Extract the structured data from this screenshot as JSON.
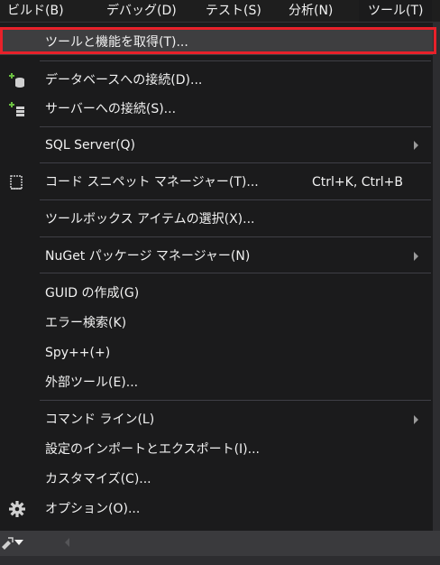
{
  "menubar": {
    "items": [
      {
        "label": "ビルド(B)"
      },
      {
        "label": "デバッグ(D)"
      },
      {
        "label": "テスト(S)"
      },
      {
        "label": "分析(N)"
      },
      {
        "label": "ツール(T)"
      }
    ]
  },
  "tools_menu": {
    "items": [
      {
        "label": "ツールと機能を取得(T)...",
        "highlighted": true
      },
      {
        "label": "データベースへの接続(D)...",
        "icon": "database-connect-icon"
      },
      {
        "label": "サーバーへの接続(S)...",
        "icon": "server-connect-icon"
      },
      {
        "label": "SQL Server(Q)",
        "submenu": true
      },
      {
        "label": "コード スニペット マネージャー(T)...",
        "shortcut": "Ctrl+K, Ctrl+B",
        "icon": "code-snippet-icon"
      },
      {
        "label": "ツールボックス アイテムの選択(X)..."
      },
      {
        "label": "NuGet パッケージ マネージャー(N)",
        "submenu": true
      },
      {
        "label": "GUID の作成(G)"
      },
      {
        "label": "エラー検索(K)"
      },
      {
        "label": "Spy++(+)"
      },
      {
        "label": "外部ツール(E)..."
      },
      {
        "label": "コマンド ライン(L)",
        "submenu": true
      },
      {
        "label": "設定のインポートとエクスポート(I)..."
      },
      {
        "label": "カスタマイズ(C)..."
      },
      {
        "label": "オプション(O)...",
        "icon": "gear-icon"
      }
    ]
  },
  "colors": {
    "highlight_border": "#e8212a",
    "menu_background": "#1b1b1c",
    "hover_background": "#3e3e40"
  }
}
